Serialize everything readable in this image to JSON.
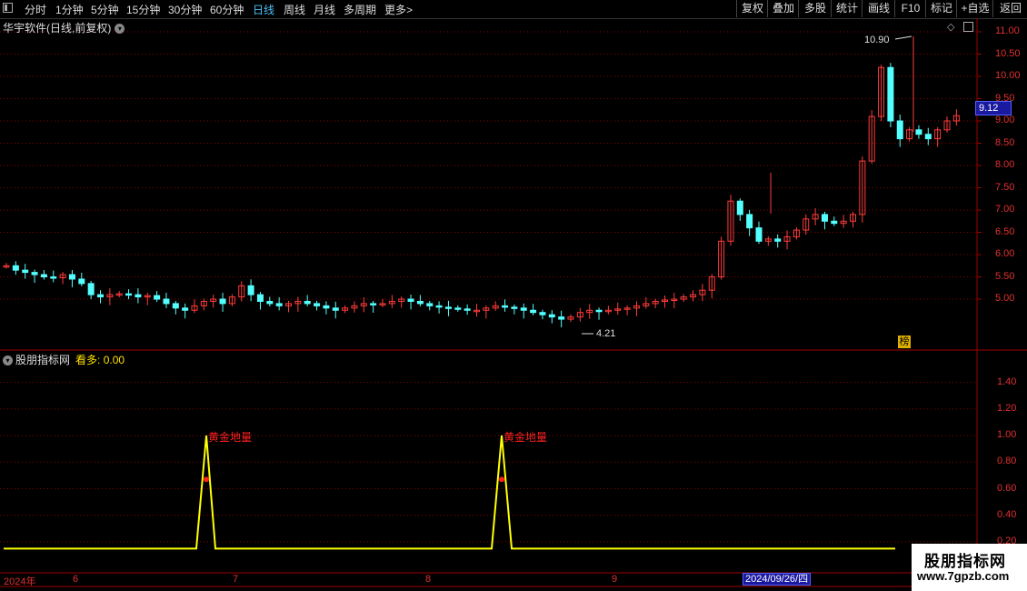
{
  "toolbar": {
    "periods": [
      "分时",
      "1分钟",
      "5分钟",
      "15分钟",
      "30分钟",
      "60分钟",
      "日线",
      "周线",
      "月线",
      "多周期",
      "更多"
    ],
    "active_period": "日线",
    "more_arrow": ">",
    "right_buttons": [
      "复权",
      "叠加",
      "多股",
      "统计",
      "画线",
      "F10",
      "标记",
      "+自选",
      "返回"
    ]
  },
  "main_chart": {
    "title": "华宇软件(日线,前复权)",
    "high_label": "10.90",
    "low_label": "4.21",
    "current_price": "9.12",
    "bang_label": "榜",
    "y_ticks": [
      "11.00",
      "10.50",
      "10.00",
      "9.50",
      "9.00",
      "8.50",
      "8.00",
      "7.50",
      "7.00",
      "6.50",
      "6.00",
      "5.50",
      "5.00"
    ]
  },
  "indicator": {
    "title": "股朋指标网",
    "series_label": "看多:",
    "series_value": "0.00",
    "signal_label": "黄金地量",
    "y_ticks": [
      "1.40",
      "1.20",
      "1.00",
      "0.80",
      "0.60",
      "0.40",
      "0.20"
    ]
  },
  "date_axis": {
    "labels": [
      "2024年",
      "6",
      "7",
      "8",
      "9"
    ],
    "highlight": "2024/09/26/四"
  },
  "watermark": {
    "name": "股朋指标网",
    "url": "www.7gpzb.com"
  },
  "colors": {
    "up": "#ff3b3b",
    "down": "#54ffff",
    "signal": "#ffff00",
    "grid": "#8b0000",
    "active": "#4fc3f7"
  }
}
